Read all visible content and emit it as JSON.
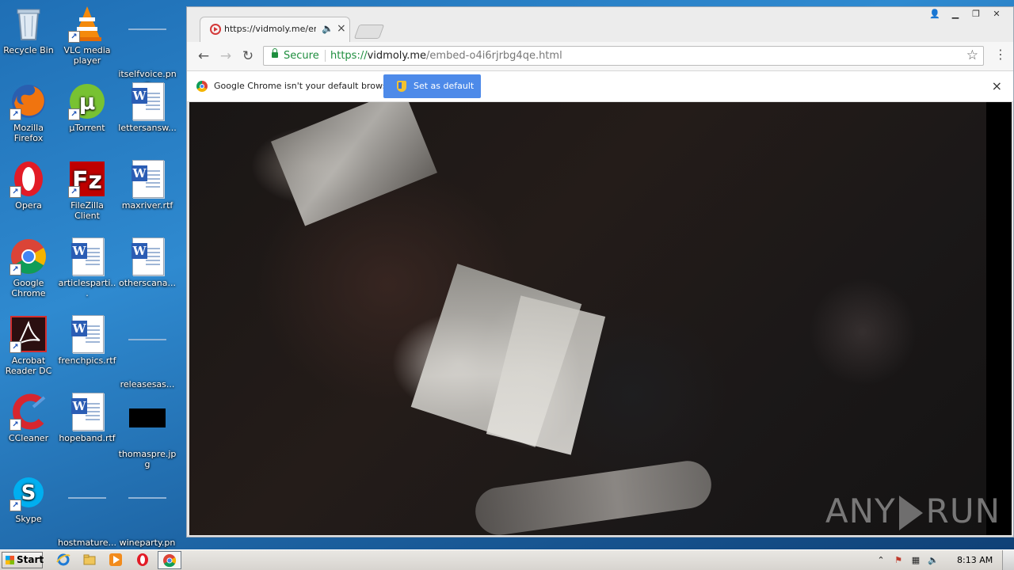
{
  "desktop": {
    "icons": [
      {
        "label": "Recycle Bin",
        "icon": "recycle-bin-icon"
      },
      {
        "label": "VLC media player",
        "icon": "vlc-icon"
      },
      {
        "label": "itselfvoice.png",
        "icon": "image-file-icon"
      },
      {
        "label": "Mozilla Firefox",
        "icon": "firefox-icon"
      },
      {
        "label": "µTorrent",
        "icon": "utorrent-icon"
      },
      {
        "label": "lettersansw...",
        "icon": "word-document-icon"
      },
      {
        "label": "Opera",
        "icon": "opera-icon"
      },
      {
        "label": "FileZilla Client",
        "icon": "filezilla-icon"
      },
      {
        "label": "maxriver.rtf",
        "icon": "word-document-icon"
      },
      {
        "label": "Google Chrome",
        "icon": "chrome-icon"
      },
      {
        "label": "articlesparti...",
        "icon": "word-document-icon"
      },
      {
        "label": "otherscana...",
        "icon": "word-document-icon"
      },
      {
        "label": "Acrobat Reader DC",
        "icon": "acrobat-icon"
      },
      {
        "label": "frenchpics.rtf",
        "icon": "word-document-icon"
      },
      {
        "label": "releasesas...",
        "icon": "blank-file-icon"
      },
      {
        "label": "CCleaner",
        "icon": "ccleaner-icon"
      },
      {
        "label": "hopeband.rtf",
        "icon": "word-document-icon"
      },
      {
        "label": "thomaspre.jpg",
        "icon": "image-file-icon"
      },
      {
        "label": "Skype",
        "icon": "skype-icon"
      },
      {
        "label": "hostmature....",
        "icon": "blank-file-icon"
      },
      {
        "label": "wineparty.png",
        "icon": "image-file-icon"
      }
    ]
  },
  "browser": {
    "tab": {
      "title": "https://vidmoly.me/emb",
      "audio_icon": "speaker-icon",
      "close": "×"
    },
    "address": {
      "secure_label": "Secure",
      "url_scheme": "https://",
      "url_host": "vidmoly.me",
      "url_path": "/embed-o4i6rjrbg4qe.html"
    },
    "infobar": {
      "message": "Google Chrome isn't your default browser.",
      "button": "Set as default",
      "close": "×"
    },
    "video": {
      "watermark_left": "ANY",
      "watermark_right": "RUN"
    }
  },
  "taskbar": {
    "start_label": "Start",
    "clock": "8:13 AM",
    "apps": [
      "internet-explorer-icon",
      "file-explorer-icon",
      "media-player-icon",
      "opera-icon",
      "chrome-icon"
    ]
  },
  "colors": {
    "secure_green": "#1e8e3e",
    "set_default_button": "#4d8ae9",
    "desktop_blue": "#2f8ad0"
  }
}
